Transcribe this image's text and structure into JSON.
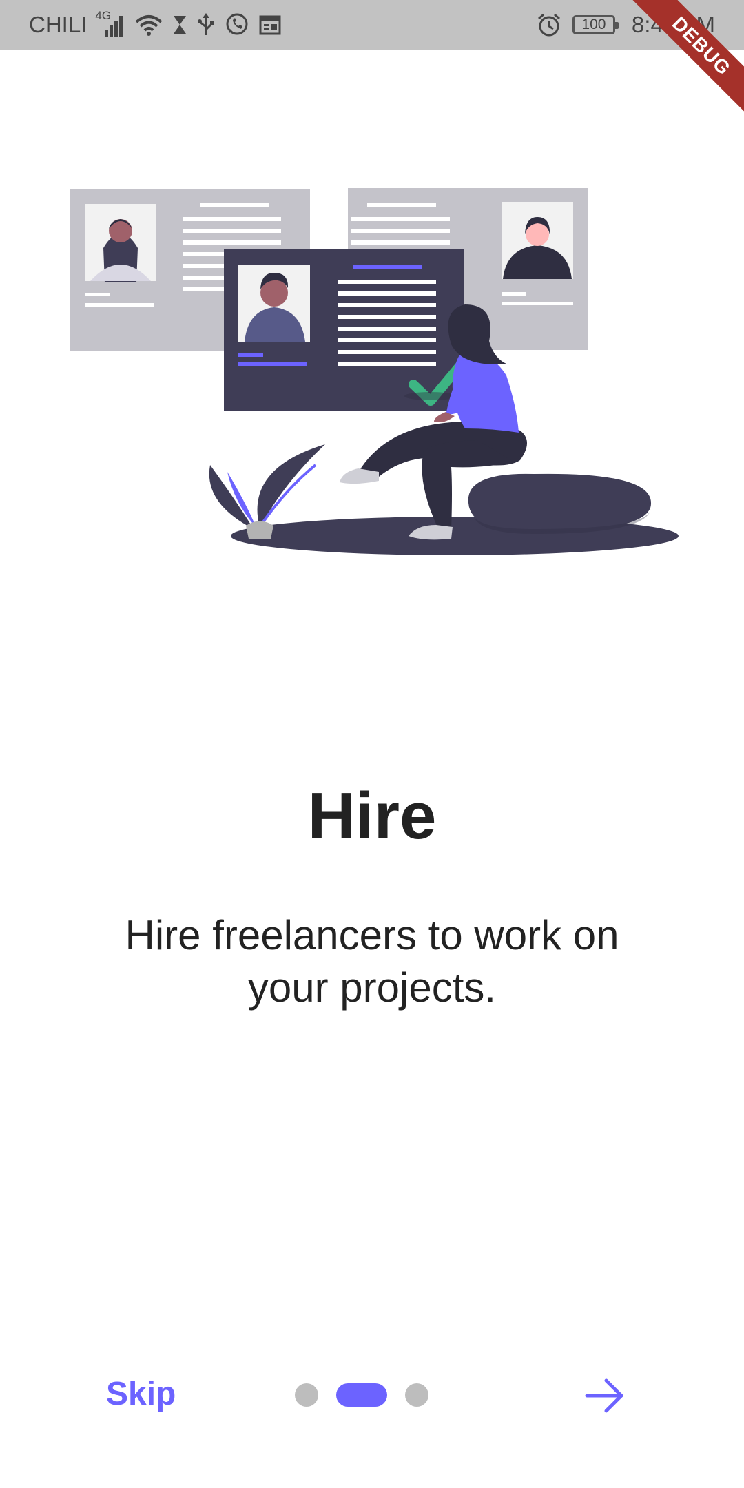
{
  "status_bar": {
    "carrier": "CHILI",
    "network": "4G",
    "battery": "100",
    "time": "8:49 AM"
  },
  "debug_banner": "DEBUG",
  "onboarding": {
    "title": "Hire",
    "description": "Hire freelancers to work on your projects.",
    "page_count": 3,
    "active_page": 2
  },
  "nav": {
    "skip_label": "Skip",
    "next_icon": "arrow-right-icon"
  },
  "colors": {
    "accent": "#6c63ff",
    "dark": "#3f3d56",
    "card_gray": "#c4c3ca",
    "inactive_dot": "#bdbdbd",
    "check": "#3db583"
  }
}
